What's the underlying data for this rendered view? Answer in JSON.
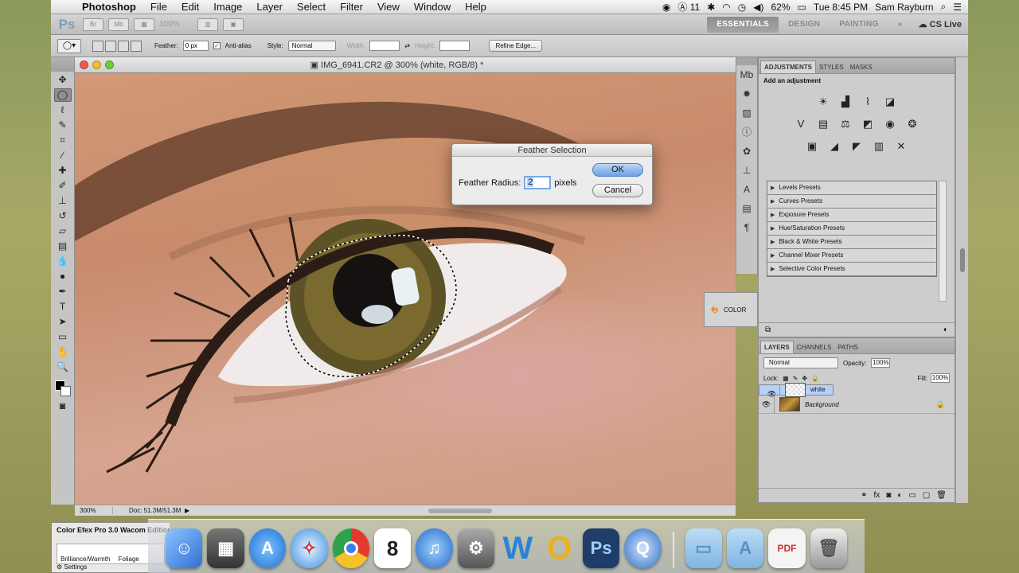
{
  "menubar": {
    "app": "Photoshop",
    "items": [
      "File",
      "Edit",
      "Image",
      "Layer",
      "Select",
      "Filter",
      "View",
      "Window",
      "Help"
    ],
    "status": {
      "battery": "62%",
      "notifications": "11",
      "clock": "Tue 8:45 PM",
      "user": "Sam Rayburn"
    }
  },
  "appbar": {
    "logo": "Ps",
    "zoom": "100%",
    "workspaces": [
      "ESSENTIALS",
      "DESIGN",
      "PAINTING"
    ],
    "more": "»",
    "cslive": "CS Live"
  },
  "options": {
    "feather_label": "Feather:",
    "feather_value": "0 px",
    "antialias_label": "Anti-alias",
    "style_label": "Style:",
    "style_value": "Normal",
    "width_label": "Width:",
    "height_label": "Height:",
    "refine_label": "Refine Edge..."
  },
  "document": {
    "title": "IMG_6941.CR2 @ 300% (white, RGB/8) *",
    "zoom": "300%",
    "doc_info": "Doc: 51.3M/51.3M"
  },
  "dialog": {
    "title": "Feather Selection",
    "radius_label": "Feather Radius:",
    "radius_value": "2",
    "unit": "pixels",
    "ok": "OK",
    "cancel": "Cancel"
  },
  "adjustments": {
    "tabs": [
      "ADJUSTMENTS",
      "STYLES",
      "MASKS"
    ],
    "heading": "Add an adjustment",
    "presets": [
      "Levels Presets",
      "Curves Presets",
      "Exposure Presets",
      "Hue/Saturation Presets",
      "Black & White Presets",
      "Channel Mixer Presets",
      "Selective Color Presets"
    ]
  },
  "color_panel": {
    "label": "COLOR"
  },
  "layers": {
    "tabs": [
      "LAYERS",
      "CHANNELS",
      "PATHS"
    ],
    "blend_mode": "Normal",
    "opacity_label": "Opacity:",
    "opacity_value": "100%",
    "lock_label": "Lock:",
    "fill_label": "Fill:",
    "fill_value": "100%",
    "items": [
      {
        "name": "white"
      },
      {
        "name": "Background"
      }
    ]
  },
  "efex": {
    "title": "Color Efex Pro 3.0 Wacom Edition",
    "filter": "Brilliance/Warmth",
    "filter2": "Foliage",
    "settings": "Settings"
  },
  "dock": {
    "apps": [
      {
        "name": "finder-icon",
        "label": "",
        "color": "#3f79d8"
      },
      {
        "name": "photo-app-icon",
        "label": "",
        "color": "#4a4a4a"
      },
      {
        "name": "app-store-icon",
        "label": "A",
        "color": "#2a7fe0"
      },
      {
        "name": "safari-icon",
        "label": "",
        "color": "#4aa2e8"
      },
      {
        "name": "chrome-icon",
        "label": "",
        "color": "#e23b2e"
      },
      {
        "name": "calendar-icon",
        "label": "8",
        "color": "#ffffff"
      },
      {
        "name": "itunes-icon",
        "label": "♫",
        "color": "#3b8ee0"
      },
      {
        "name": "system-preferences-icon",
        "label": "⚙",
        "color": "#8a8a8a"
      },
      {
        "name": "word-icon",
        "label": "W",
        "color": "#2c82d6"
      },
      {
        "name": "outlook-icon",
        "label": "O",
        "color": "#e9b21a"
      },
      {
        "name": "photoshop-icon",
        "label": "Ps",
        "color": "#1f3d69"
      },
      {
        "name": "quicktime-icon",
        "label": "Q",
        "color": "#2e6ec2"
      }
    ]
  }
}
